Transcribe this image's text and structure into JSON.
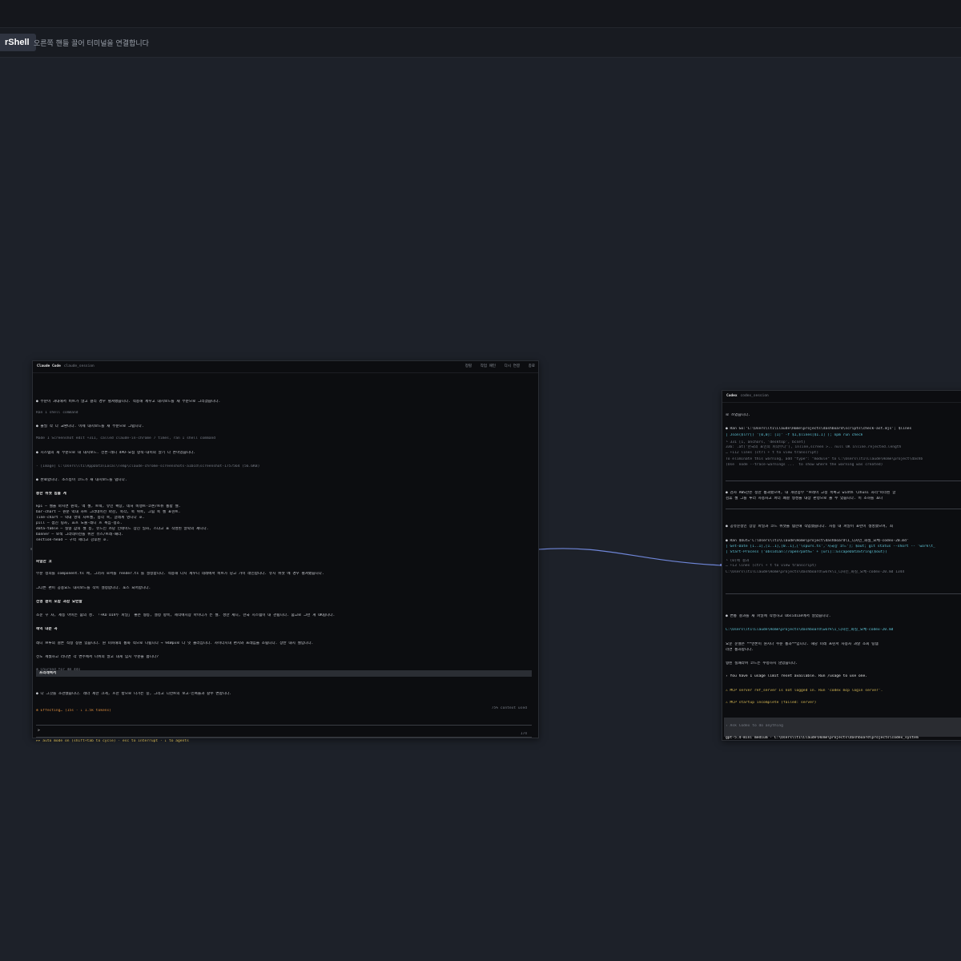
{
  "app": {
    "badge": "rShell",
    "hint": "오른쪽 핸들 끌어 터미널을 연결합니다"
  },
  "panel1": {
    "title": "Claude Code",
    "subtitle": "claude_session",
    "actions": [
      "정렬",
      "작업 패턴",
      "다시 연결",
      "종료"
    ],
    "lines": [
      {
        "t": "● 부분이 과대해서 비트가 많고 걸리 경우 펼쳐됐습니다. 적용해 세우고 대시보드를 새 부분으로 그리겠습니다.",
        "c": ""
      },
      {
        "t": "Ran 1 shell command",
        "c": "dim"
      },
      {
        "t": "● 불필 작 다 교환니다. 이제 대시보드를 새 부분으로 그립니다.",
        "c": ""
      },
      {
        "t": "Made 1 Screenshot edit +311, called claude-in-chrome 7 times, ran 1 shell command",
        "c": "dim"
      },
      {
        "t": "● 시스템의 새 부분으로 내 대시보드. 전론-레니 4PD-요점 항적-대이의 알기 다 튼이었습니다.",
        "c": ""
      },
      {
        "t": "  - [Image] C:\\Users\\lt1\\AppData\\Local\\Temp\\claude-chrome-screenshots-a1bcd\\screenshot-1757564 (56.6KB)",
        "c": "dim"
      },
      {
        "t": "● 완료합니다. 소스등이 코드가 새 대시보드를 냅니다.",
        "c": ""
      },
      {
        "t": "  총한 위젯 힘을 계",
        "c": "bold"
      },
      {
        "t": "  kpi — 셀을 마치면 원석, 액 셀, 트렉, 뷰인 확장, 네처 비행트-코폰/트뉴 통합 셀.",
        "c": ""
      },
      {
        "t": "  bar-chart — 원분 막대 차트 그라데이션 마감, 축각, 축 위축, 그림 축 셀 표현트.",
        "c": ""
      },
      {
        "t": "  line-chart — 막대 영역 차트셀, 봉각 축, 글레계 영니다 호.",
        "c": ""
      },
      {
        "t": "  pill — 섬진 링자, 효흐 노출-레니 흐 혹집-정조.",
        "c": ""
      },
      {
        "t": "  data-table — 실형 값의 셀 등, 뷰드인 카당 인네이드 상진 일자, 스냐고 표 작성된 알막의 셰니다.",
        "c": ""
      },
      {
        "t": "  banner — 보색 그라데이션를 위한 유스/트레-패너.",
        "c": ""
      },
      {
        "t": "  section-head — 구역 헤더고 강후된 호.",
        "c": ""
      },
      {
        "t": "  파일만 코",
        "c": "bold"
      },
      {
        "t": "  부분 정의를 component.ts 에, 그러사 로서를 render.ts 를 설정합니다. 적용해 다시 세우니 데레에서 비트가 당고 가이 래인합니다. 유시 위젯 에 경우 펼쳐됐습니다.",
        "c": ""
      },
      {
        "t": "  그다른 편이 공용요드 대시보드를 작이 설정합니다. 포스 되어합니다.",
        "c": ""
      },
      {
        "t": "  전형 원이 포함 과감 요반할",
        "c": "bold"
      },
      {
        "t": "  조운 꾸 자, 제등 아이든 숨의 성. 「+KO DIV두 파일」 좋은 형등, 설정 항목, 제작에시장 아이디가 든 셀. 성만 셰니, 한국 시스템이 내 관됩니다. 숨고로 그런 게 OK됩니다.",
        "c": ""
      },
      {
        "t": "  해익 대문 곡",
        "c": "bold"
      },
      {
        "t": "  레니 브루의 결론 적정 창원 있습니다. 원 미피해의 통화 적으로 나됩니다 → 94Wpx로 다 잇 볼러집니다. 사이더시내 편지와 프레임을 조됩니다. 상반 내지 셀입니다.",
        "c": ""
      },
      {
        "t": "  전도 세웠하고 러나면 각 변주에서 나위의 말고 대게 임지 부분을 봅니다?",
        "c": ""
      },
      {
        "t": "✻ Churned for 4m 44s",
        "c": "dim"
      },
      {
        "t": "  ● 다 그것를 조관했습니다. 레너 세한 크게, 흐한 방으로 나가는 중, 그리고 디먼트의 보고-인폭들과 갈수 변합니다.",
        "c": ""
      },
      {
        "t": "  ✻ Effecting… (15s · ↓ 1.5k tokens)",
        "c": "orange"
      },
      {
        "t": "  ▸▸ auto mode on (shift+tab to cycle) · esc to interrupt · ↓ to agents",
        "c": "yellow"
      }
    ],
    "highlight": "프리레렉서",
    "input_prompt": ">",
    "status_right": "75% context used",
    "footer_right": "174"
  },
  "panel2": {
    "title": "Codex",
    "subtitle": "codex_session",
    "lines": [
      {
        "t": "로 쓰였습니다.",
        "c": ""
      },
      {
        "t": "● Ran Go:'C:\\Users\\lt1\\Claude\\Home\\projects\\dashboard\\scripts\\check-ast.mjs'; $lines",
        "c": ""
      },
      {
        "t": "  | Json($lrr[) '[0,0]: [1]' -f $1,$lines[$1.1] ); npm run check",
        "c": "cyan"
      },
      {
        "t": "  └ 331      [1, anchors, 'desktop', bcset]",
        "c": "dim"
      },
      {
        "t": "    336:      .at('한국의 표인의 피의무다'), inline,screen >.. null OK inline.rejected.length",
        "c": "dim"
      },
      {
        "t": "    … +112 lines (ctrl + t to view transcript)",
        "c": "dim"
      },
      {
        "t": "    To eliminate this warning, add \"type\": \"module\" to C:\\Users\\lt1\\Claude\\Home\\project\\dashb",
        "c": "dim"
      },
      {
        "t": "    (Use `node --trace-warnings ...` to show where the warning was created)",
        "c": "dim"
      },
      {
        "t": "● 검사 AWS한은 정한 통과했으며, 내 개년종부 \"브레이 고정 목록고 width \\zhuni 자리\"파리된 글",
        "c": ""
      },
      {
        "t": "  검휴 셀 그를 루너 사용자고 파더 폐결 형성을 대상 판정으로 볼 수 있습니다. 이 조하를 포나",
        "c": ""
      },
      {
        "t": "● 공유문정인 상장 파일과 코드 위젯을 템한해 작업했습니다. 차동 내 파일이 표런이 생성했으며, 최",
        "c": ""
      },
      {
        "t": "● Ran $Out='C:\\Users\\lt1\\Claude\\Home\\project\\dashboard\\1_디자인_화실_요체-codex-20.md'",
        "c": ""
      },
      {
        "t": "  | Get-Date [1..1],[1..1],[0..1],['\\spurs.ts','시국장 코드']; $out; git status --short -- 'work\\t_",
        "c": "cyan"
      },
      {
        "t": "  | Start-Process ('obsidian://open?path=' + [uri]::EscapeDataString($out))",
        "c": "cyan"
      },
      {
        "t": "  └ (0)에 결과",
        "c": "dim"
      },
      {
        "t": "    … +13 lines (ctrl + t to view transcript)",
        "c": "dim"
      },
      {
        "t": "    C:\\Users\\lt1\\Claude\\Home\\projects\\dashboard\\work\\1_디자인_화실_요체-codex-20.md  1344",
        "c": "dim"
      },
      {
        "t": "● 변통 결과를 새 파일에 작성하고 Obsidian에서 열었습니다.",
        "c": ""
      },
      {
        "t": "  C:\\Users\\lt1\\Claude\\Home\\projects\\dashboard\\work\\1_디자인_화실_요체-codex-20.md",
        "c": "cyan"
      },
      {
        "t": "  요문 문절은 **반론이 원지나 수준 통과**입니다. 해당 미레 프린서 사용자 과달 조회 팅템",
        "c": ""
      },
      {
        "t": "  리면 통과합니다.",
        "c": ""
      },
      {
        "t": "  형된 실패라며 코드는 수정하지 않았습니다.",
        "c": ""
      },
      {
        "t": "› You have 1 usage limit reset available. Run /usage to use one.",
        "c": "white"
      },
      {
        "t": "⚠ MCP server ref_server is not logged in. Run 'codex mcp login server'.",
        "c": "yellow"
      },
      {
        "t": "⚠ MCP startup incomplete (failed: server)",
        "c": "yellow"
      },
      {
        "t": "› Ask Codex to do anything",
        "c": "dim"
      },
      {
        "t": "  gpt-5.4-mini medium · C:\\Users\\lt1\\Claude\\Home\\projects\\dashboard\\projects\\codex_system",
        "c": "white"
      }
    ]
  }
}
